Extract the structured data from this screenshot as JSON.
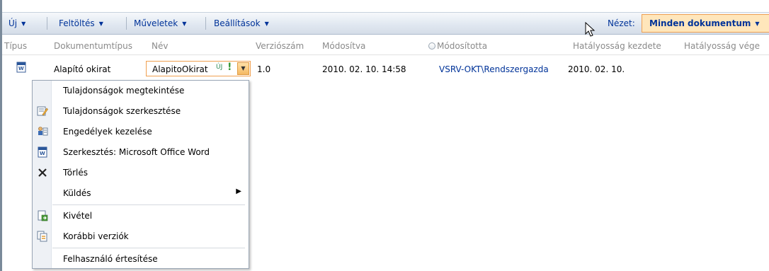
{
  "toolbar": {
    "new_label": "Új",
    "upload_label": "Feltöltés",
    "actions_label": "Műveletek",
    "settings_label": "Beállítások",
    "view_label": "Nézet:",
    "view_value": "Minden dokumentum",
    "caret": "▼"
  },
  "columns": {
    "type": "Típus",
    "doc_type": "Dokumentumtípus",
    "name": "Név",
    "version": "Verziószám",
    "modified": "Módosítva",
    "modified_by": "Módosította",
    "valid_from": "Hatályosság kezdete",
    "valid_to": "Hatályosság vége"
  },
  "row": {
    "doc_type": "Alapító okirat",
    "name": "AlapitoOkirat",
    "new_badge": "ÚJ",
    "new_bang": "!",
    "version": "1.0",
    "modified": "2010. 02. 10. 14:58",
    "modified_by": "VSRV-OKT\\Rendszergazda",
    "valid_from": "2010. 02. 10."
  },
  "menu": {
    "items": [
      {
        "label": "Tulajdonságok megtekintése",
        "icon": ""
      },
      {
        "label": "Tulajdonságok szerkesztése",
        "icon": "edit-properties-icon"
      },
      {
        "label": "Engedélyek kezelése",
        "icon": "permissions-icon"
      },
      {
        "label": "Szerkesztés: Microsoft Office Word",
        "icon": "word-icon"
      },
      {
        "label": "Törlés",
        "icon": "delete-icon"
      },
      {
        "label": "Küldés",
        "icon": "",
        "submenu": "▶"
      },
      {
        "label": "Kivétel",
        "icon": "check-out-icon"
      },
      {
        "label": "Korábbi verziók",
        "icon": "version-history-icon"
      },
      {
        "label": "Felhasználó értesítése",
        "icon": ""
      }
    ]
  },
  "colors": {
    "link": "#003399",
    "highlight_border": "#f0a050",
    "view_bg": "#ffe6bb"
  }
}
